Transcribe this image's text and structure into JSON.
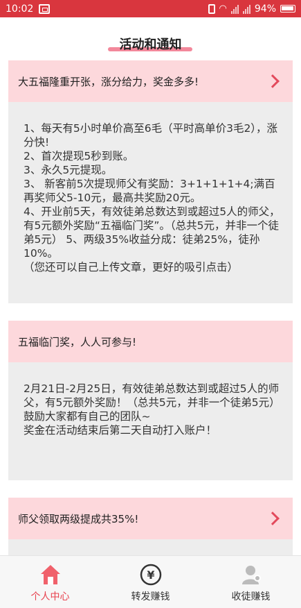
{
  "status_bar": {
    "time": "10:02",
    "battery": "94%"
  },
  "page": {
    "title": "活动和通知"
  },
  "cards": [
    {
      "title": "大五福隆重开张，涨分给力，奖金多多!",
      "has_arrow": true,
      "lines": [
        "1、每天有5小时单价高至6毛（平时高单价3毛2），涨分快!",
        "2、首次提现5秒到账。",
        "3、永久5元提现。",
        "3、 新客前5次提现师父有奖励：3+1+1+1+4;满百再奖师父5-10元，最高共奖励20元。",
        "4、开业前5天，有效徒弟总数达到或超过5人的师父，有5元额外奖励“五福临门奖”。（总共5元，并非一个徒弟5元） 5、两级35%收益分成：徒弟25%，徒孙10%。",
        "（您还可以自己上传文章，更好的吸引点击）"
      ]
    },
    {
      "title": "五福临门奖，人人可参与!",
      "has_arrow": false,
      "lines": [
        "2月21日-2月25日，有效徒弟总数达到或超过5人的师父，有5元额外奖励！（总共5元，并非一个徒弟5元）",
        "鼓励大家都有自己的团队~",
        "奖金在活动结束后第二天自动打入账户！"
      ]
    },
    {
      "title": "师父领取两级提成共35%!",
      "has_arrow": true
    }
  ],
  "bottom_nav": [
    {
      "label": "个人中心",
      "icon": "home-icon",
      "active": true
    },
    {
      "label": "转发赚钱",
      "icon": "coin-icon",
      "active": false
    },
    {
      "label": "收徒赚钱",
      "icon": "person-icon",
      "active": false
    }
  ],
  "colors": {
    "status_bar": "#d9363e",
    "accent": "#e8424f",
    "card_header": "#fdd8dc",
    "card_body": "#ededed"
  }
}
